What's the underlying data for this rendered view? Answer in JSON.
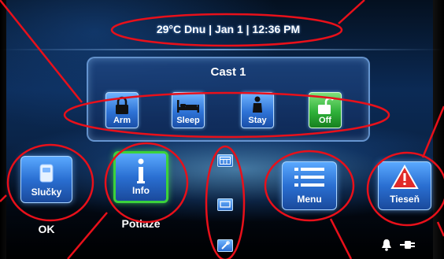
{
  "status_bar": {
    "text": "29°C Dnu | Jan  1 | 12:36 PM"
  },
  "partition": {
    "title": "Cast 1",
    "modes": [
      {
        "label": "Arm",
        "icon": "lock-closed-icon"
      },
      {
        "label": "Sleep",
        "icon": "bed-icon"
      },
      {
        "label": "Stay",
        "icon": "person-icon"
      },
      {
        "label": "Off",
        "icon": "lock-open-icon",
        "color": "#2fb13a"
      }
    ]
  },
  "bottom": {
    "zones": {
      "label": "Slučky",
      "status": "OK",
      "icon": "device-icon"
    },
    "info": {
      "label": "Info",
      "caption": "Potiaze",
      "icon": "info-icon"
    },
    "menu": {
      "label": "Menu",
      "icon": "list-icon"
    },
    "panic": {
      "label": "Tieseň",
      "icon": "warning-icon"
    },
    "small_buttons": [
      {
        "icon": "calendar-icon"
      },
      {
        "icon": "screen-icon"
      },
      {
        "icon": "tools-icon"
      }
    ],
    "status_icons": [
      "bell-icon",
      "power-plug-icon"
    ]
  },
  "colors": {
    "accent": "#2a6fd2",
    "off_green": "#2fb13a",
    "annotation": "#e8101a",
    "panic": "#e02a2a"
  }
}
